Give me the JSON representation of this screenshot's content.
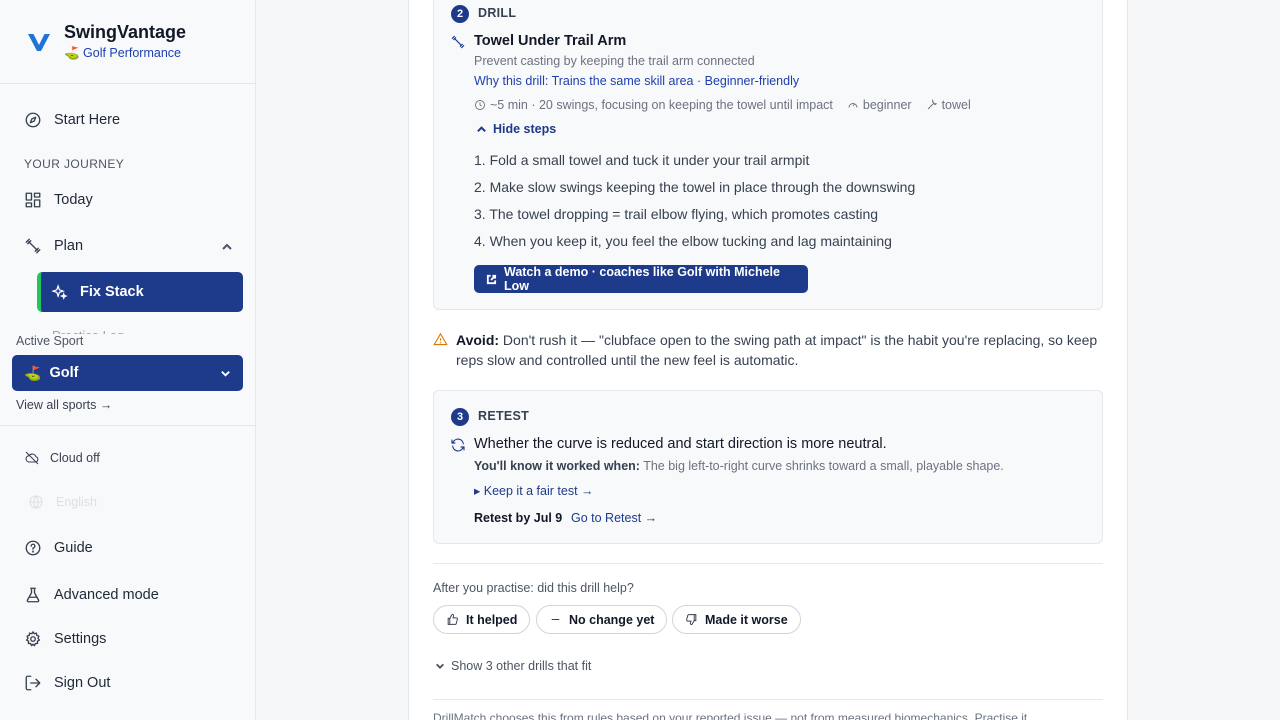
{
  "brand": {
    "name": "SwingVantage",
    "subtitle": "⛳ Golf Performance"
  },
  "nav": {
    "start_here": "Start Here",
    "section_label": "YOUR JOURNEY",
    "today": "Today",
    "plan": "Plan",
    "fix_stack": "Fix Stack",
    "practice_partial": "Practice Log",
    "active_sport_label": "Active Sport",
    "active_sport": "Golf",
    "active_sport_flag": "⛳",
    "view_all": "View all sports →",
    "cloud_off": "Cloud off",
    "language": "English",
    "guide": "Guide",
    "advanced": "Advanced mode",
    "settings": "Settings",
    "sign_out": "Sign Out"
  },
  "drill": {
    "step_number": "2",
    "step_label": "DRILL",
    "name": "Towel Under Trail Arm",
    "description": "Prevent casting by keeping the trail arm connected",
    "why": "Why this drill: Trains the same skill area · Beginner-friendly",
    "duration": "~5 min · 20 swings, focusing on keeping the towel until impact",
    "level": "beginner",
    "equipment": "towel",
    "hide_steps": "Hide steps",
    "steps": [
      "1. Fold a small towel and tuck it under your trail armpit",
      "2. Make slow swings keeping the towel in place through the downswing",
      "3. The towel dropping = trail elbow flying, which promotes casting",
      "4. When you keep it, you feel the elbow tucking and lag maintaining"
    ],
    "demo_button": "Watch a demo · coaches like Golf with Michele Low"
  },
  "avoid": {
    "label": "Avoid:",
    "text": " Don't rush it — \"clubface open to the swing path at impact\" is the habit you're replacing, so keep reps slow and controlled until the new feel is automatic."
  },
  "retest": {
    "step_number": "3",
    "step_label": "RETEST",
    "question": "Whether the curve is reduced and start direction is more neutral.",
    "know_label": "You'll know it worked when:",
    "know_text": " The big left-to-right curve shrinks toward a small, playable shape.",
    "fair_test": "▸ Keep it a fair test →",
    "retest_by": "Retest by Jul 9",
    "goto": "Go to Retest →"
  },
  "feedback": {
    "question": "After you practise: did this drill help?",
    "helped": "It helped",
    "no_change": "No change yet",
    "worse": "Made it worse",
    "show_other": "Show 3 other drills that fit"
  },
  "disclaimer": "DrillMatch chooses this from rules based on your reported issue — not from measured biomechanics. Practise it"
}
